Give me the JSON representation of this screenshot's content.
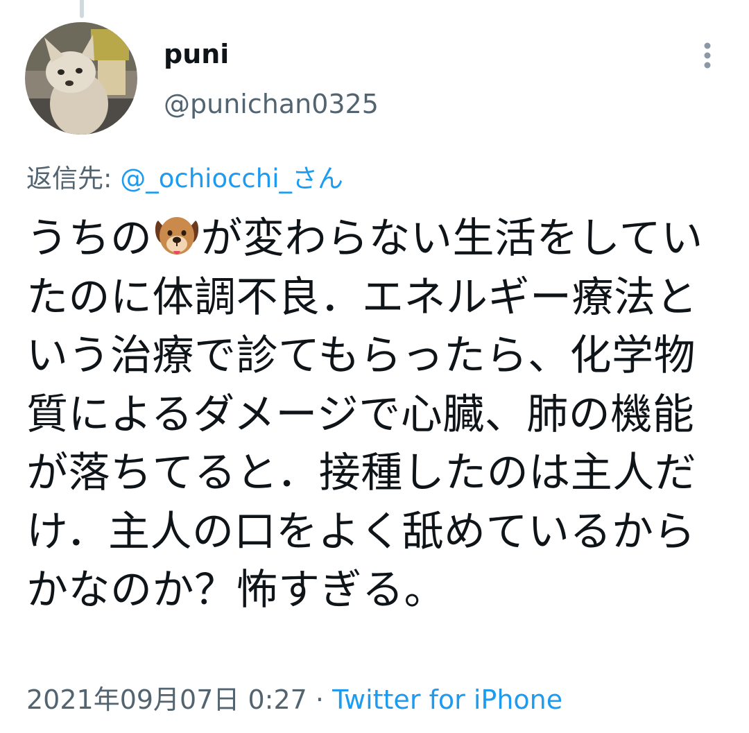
{
  "tweet": {
    "author": {
      "display_name": "puni",
      "handle": "@punichan0325"
    },
    "reply_to": {
      "prefix": "返信先: ",
      "handle": "@_ochiocchi_さん"
    },
    "text_before_emoji": "うちの",
    "emoji": "dog-face-icon",
    "text_after_emoji": "が変わらない生活をしていたのに体調不良．エネルギー療法という治療で診てもらったら、化学物質によるダメージで心臓、肺の機能が落ちてると．接種したのは主人だけ．主人の口をよく舐めているからかなのか？怖すぎる。",
    "timestamp": "2021年09月07日 0:27",
    "separator": " · ",
    "source": "Twitter for iPhone"
  },
  "colors": {
    "text": "#0f1419",
    "secondary": "#536471",
    "accent": "#1d9bf0"
  }
}
